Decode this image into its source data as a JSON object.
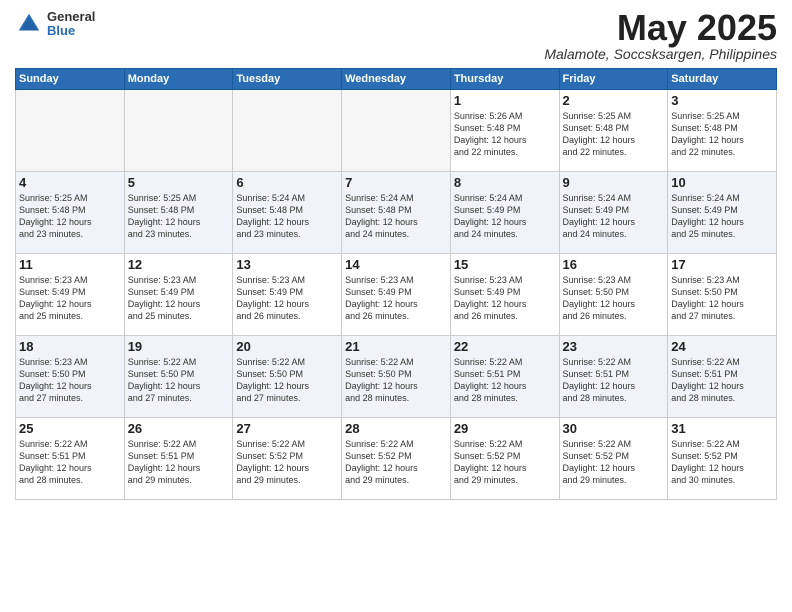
{
  "logo": {
    "general": "General",
    "blue": "Blue"
  },
  "title": {
    "month_year": "May 2025",
    "location": "Malamote, Soccsksargen, Philippines"
  },
  "weekdays": [
    "Sunday",
    "Monday",
    "Tuesday",
    "Wednesday",
    "Thursday",
    "Friday",
    "Saturday"
  ],
  "weeks": [
    [
      {
        "day": "",
        "info": ""
      },
      {
        "day": "",
        "info": ""
      },
      {
        "day": "",
        "info": ""
      },
      {
        "day": "",
        "info": ""
      },
      {
        "day": "1",
        "info": "Sunrise: 5:26 AM\nSunset: 5:48 PM\nDaylight: 12 hours\nand 22 minutes."
      },
      {
        "day": "2",
        "info": "Sunrise: 5:25 AM\nSunset: 5:48 PM\nDaylight: 12 hours\nand 22 minutes."
      },
      {
        "day": "3",
        "info": "Sunrise: 5:25 AM\nSunset: 5:48 PM\nDaylight: 12 hours\nand 22 minutes."
      }
    ],
    [
      {
        "day": "4",
        "info": "Sunrise: 5:25 AM\nSunset: 5:48 PM\nDaylight: 12 hours\nand 23 minutes."
      },
      {
        "day": "5",
        "info": "Sunrise: 5:25 AM\nSunset: 5:48 PM\nDaylight: 12 hours\nand 23 minutes."
      },
      {
        "day": "6",
        "info": "Sunrise: 5:24 AM\nSunset: 5:48 PM\nDaylight: 12 hours\nand 23 minutes."
      },
      {
        "day": "7",
        "info": "Sunrise: 5:24 AM\nSunset: 5:48 PM\nDaylight: 12 hours\nand 24 minutes."
      },
      {
        "day": "8",
        "info": "Sunrise: 5:24 AM\nSunset: 5:49 PM\nDaylight: 12 hours\nand 24 minutes."
      },
      {
        "day": "9",
        "info": "Sunrise: 5:24 AM\nSunset: 5:49 PM\nDaylight: 12 hours\nand 24 minutes."
      },
      {
        "day": "10",
        "info": "Sunrise: 5:24 AM\nSunset: 5:49 PM\nDaylight: 12 hours\nand 25 minutes."
      }
    ],
    [
      {
        "day": "11",
        "info": "Sunrise: 5:23 AM\nSunset: 5:49 PM\nDaylight: 12 hours\nand 25 minutes."
      },
      {
        "day": "12",
        "info": "Sunrise: 5:23 AM\nSunset: 5:49 PM\nDaylight: 12 hours\nand 25 minutes."
      },
      {
        "day": "13",
        "info": "Sunrise: 5:23 AM\nSunset: 5:49 PM\nDaylight: 12 hours\nand 26 minutes."
      },
      {
        "day": "14",
        "info": "Sunrise: 5:23 AM\nSunset: 5:49 PM\nDaylight: 12 hours\nand 26 minutes."
      },
      {
        "day": "15",
        "info": "Sunrise: 5:23 AM\nSunset: 5:49 PM\nDaylight: 12 hours\nand 26 minutes."
      },
      {
        "day": "16",
        "info": "Sunrise: 5:23 AM\nSunset: 5:50 PM\nDaylight: 12 hours\nand 26 minutes."
      },
      {
        "day": "17",
        "info": "Sunrise: 5:23 AM\nSunset: 5:50 PM\nDaylight: 12 hours\nand 27 minutes."
      }
    ],
    [
      {
        "day": "18",
        "info": "Sunrise: 5:23 AM\nSunset: 5:50 PM\nDaylight: 12 hours\nand 27 minutes."
      },
      {
        "day": "19",
        "info": "Sunrise: 5:22 AM\nSunset: 5:50 PM\nDaylight: 12 hours\nand 27 minutes."
      },
      {
        "day": "20",
        "info": "Sunrise: 5:22 AM\nSunset: 5:50 PM\nDaylight: 12 hours\nand 27 minutes."
      },
      {
        "day": "21",
        "info": "Sunrise: 5:22 AM\nSunset: 5:50 PM\nDaylight: 12 hours\nand 28 minutes."
      },
      {
        "day": "22",
        "info": "Sunrise: 5:22 AM\nSunset: 5:51 PM\nDaylight: 12 hours\nand 28 minutes."
      },
      {
        "day": "23",
        "info": "Sunrise: 5:22 AM\nSunset: 5:51 PM\nDaylight: 12 hours\nand 28 minutes."
      },
      {
        "day": "24",
        "info": "Sunrise: 5:22 AM\nSunset: 5:51 PM\nDaylight: 12 hours\nand 28 minutes."
      }
    ],
    [
      {
        "day": "25",
        "info": "Sunrise: 5:22 AM\nSunset: 5:51 PM\nDaylight: 12 hours\nand 28 minutes."
      },
      {
        "day": "26",
        "info": "Sunrise: 5:22 AM\nSunset: 5:51 PM\nDaylight: 12 hours\nand 29 minutes."
      },
      {
        "day": "27",
        "info": "Sunrise: 5:22 AM\nSunset: 5:52 PM\nDaylight: 12 hours\nand 29 minutes."
      },
      {
        "day": "28",
        "info": "Sunrise: 5:22 AM\nSunset: 5:52 PM\nDaylight: 12 hours\nand 29 minutes."
      },
      {
        "day": "29",
        "info": "Sunrise: 5:22 AM\nSunset: 5:52 PM\nDaylight: 12 hours\nand 29 minutes."
      },
      {
        "day": "30",
        "info": "Sunrise: 5:22 AM\nSunset: 5:52 PM\nDaylight: 12 hours\nand 29 minutes."
      },
      {
        "day": "31",
        "info": "Sunrise: 5:22 AM\nSunset: 5:52 PM\nDaylight: 12 hours\nand 30 minutes."
      }
    ]
  ]
}
